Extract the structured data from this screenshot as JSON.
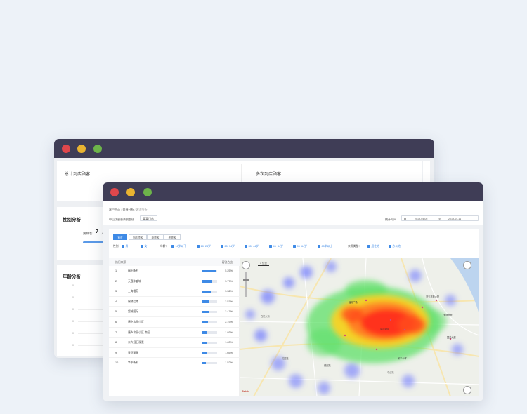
{
  "back_window": {
    "cards": {
      "total_visitors": "总计到店顾客",
      "repeat_visitors": "多次到店顾客",
      "gender_title": "性别分析",
      "gender_label": "男顾客：",
      "gender_value": "7",
      "gender_unit": "人",
      "age_title": "年龄分析"
    },
    "age_ticks": [
      "0",
      "0",
      "0",
      "0",
      "0",
      "0"
    ]
  },
  "front_window": {
    "breadcrumb": {
      "item1": "客户中心",
      "item2": "来源分析",
      "item3": "客流分析"
    },
    "store_name": "中山优越香茶税超级",
    "store_select": "某某门店",
    "date_label": "统计时间",
    "date_start": "2019-04-05",
    "date_sep": "至",
    "date_end": "2019-04-11",
    "tabs": [
      "首页",
      "到店顾客",
      "新顾客",
      "老顾客"
    ],
    "gender": {
      "label": "性别：",
      "options": [
        "男",
        "女"
      ]
    },
    "age": {
      "label": "年龄：",
      "options": [
        "18岁以下",
        "18~24岁",
        "25~34岁",
        "35~44岁",
        "45~54岁",
        "55~64岁",
        "65岁以上"
      ]
    },
    "source": {
      "label": "来源类型：",
      "options": [
        "居住地",
        "办公地"
      ]
    },
    "table": {
      "col_source": "热门来源",
      "col_share": "客流占比",
      "rows": [
        {
          "rank": "1",
          "name": "福田新村",
          "pct": "5.25%",
          "share": 0.95
        },
        {
          "rank": "2",
          "name": "天鹿丰盛城",
          "pct": "3.77%",
          "share": 0.68
        },
        {
          "rank": "3",
          "name": "上海雷苑",
          "pct": "3.32%",
          "share": 0.6
        },
        {
          "rank": "4",
          "name": "锦绣江南",
          "pct": "2.57%",
          "share": 0.47
        },
        {
          "rank": "5",
          "name": "超城国际",
          "pct": "2.47%",
          "share": 0.45
        },
        {
          "rank": "6",
          "name": "唐乡和丽小区",
          "pct": "2.19%",
          "share": 0.4
        },
        {
          "rank": "7",
          "name": "唐乡和丽小区-南区",
          "pct": "1.93%",
          "share": 0.35
        },
        {
          "rank": "8",
          "name": "东大昌日观景",
          "pct": "1.63%",
          "share": 0.3
        },
        {
          "rank": "9",
          "name": "景河丽景",
          "pct": "1.65%",
          "share": 0.3
        },
        {
          "rank": "10",
          "name": "华中新村",
          "pct": "1.52%",
          "share": 0.28
        }
      ]
    },
    "map": {
      "scale_text": "1 公里",
      "watermark": "Baidu",
      "road_labels": [
        "西门大街",
        "花园路",
        "中山路"
      ],
      "poi_labels": [
        "蓝天花苑大厦",
        "天河大厦",
        "国芳大厦",
        "福利广场",
        "中心公园",
        "德庆路",
        "和平小学"
      ]
    },
    "colors": {
      "accent": "#3e8ae6",
      "titlebar": "#3f3d56"
    }
  }
}
